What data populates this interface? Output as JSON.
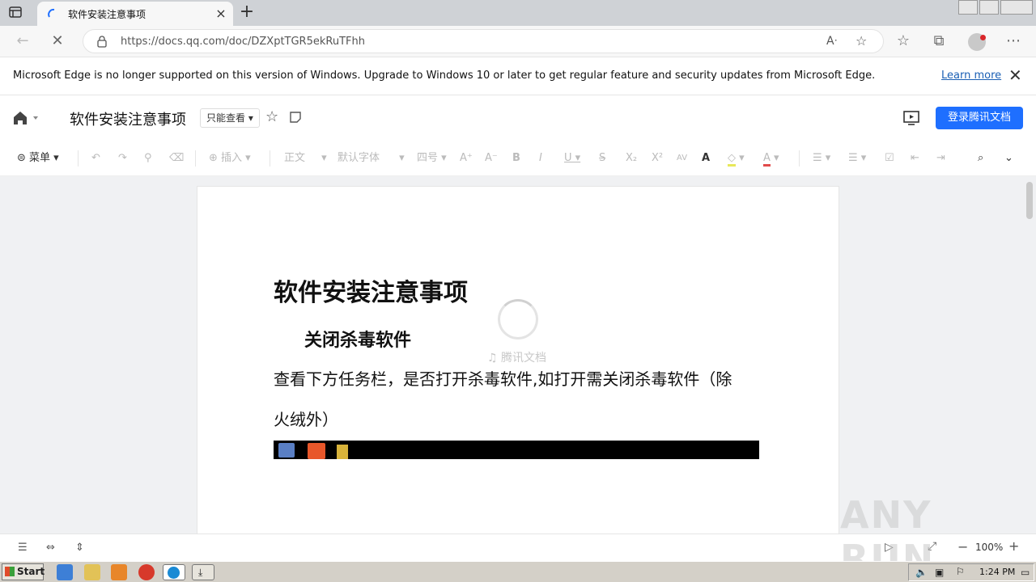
{
  "browser": {
    "tab_title": "软件安装注意事项",
    "url": "https://docs.qq.com/doc/DZXptTGR5ekRuTFhh"
  },
  "infobar": {
    "message": "Microsoft Edge is no longer supported on this version of Windows. Upgrade to Windows 10 or later to get regular feature and security updates from Microsoft Edge.",
    "learn_more": "Learn more"
  },
  "doc_header": {
    "title": "软件安装注意事项",
    "permission": "只能查看",
    "login_label": "登录腾讯文档"
  },
  "toolbar": {
    "menu_label": "菜单",
    "insert_label": "插入",
    "style_label": "正文",
    "font_label": "默认字体",
    "size_label": "四号"
  },
  "document": {
    "heading": "软件安装注意事项",
    "subheading": "关闭杀毒软件",
    "paragraph_line1": "查看下方任务栏，是否打开杀毒软件,如打开需关闭杀毒软件（除",
    "paragraph_line2": "火绒外）",
    "loading_brand": "腾讯文档"
  },
  "statusbar": {
    "zoom": "100%"
  },
  "windows": {
    "start_label": "Start",
    "clock": "1:24 PM"
  },
  "watermark": "ANY RUN",
  "colors": {
    "primary_button": "#1e6fff",
    "link": "#1a5fb4"
  }
}
